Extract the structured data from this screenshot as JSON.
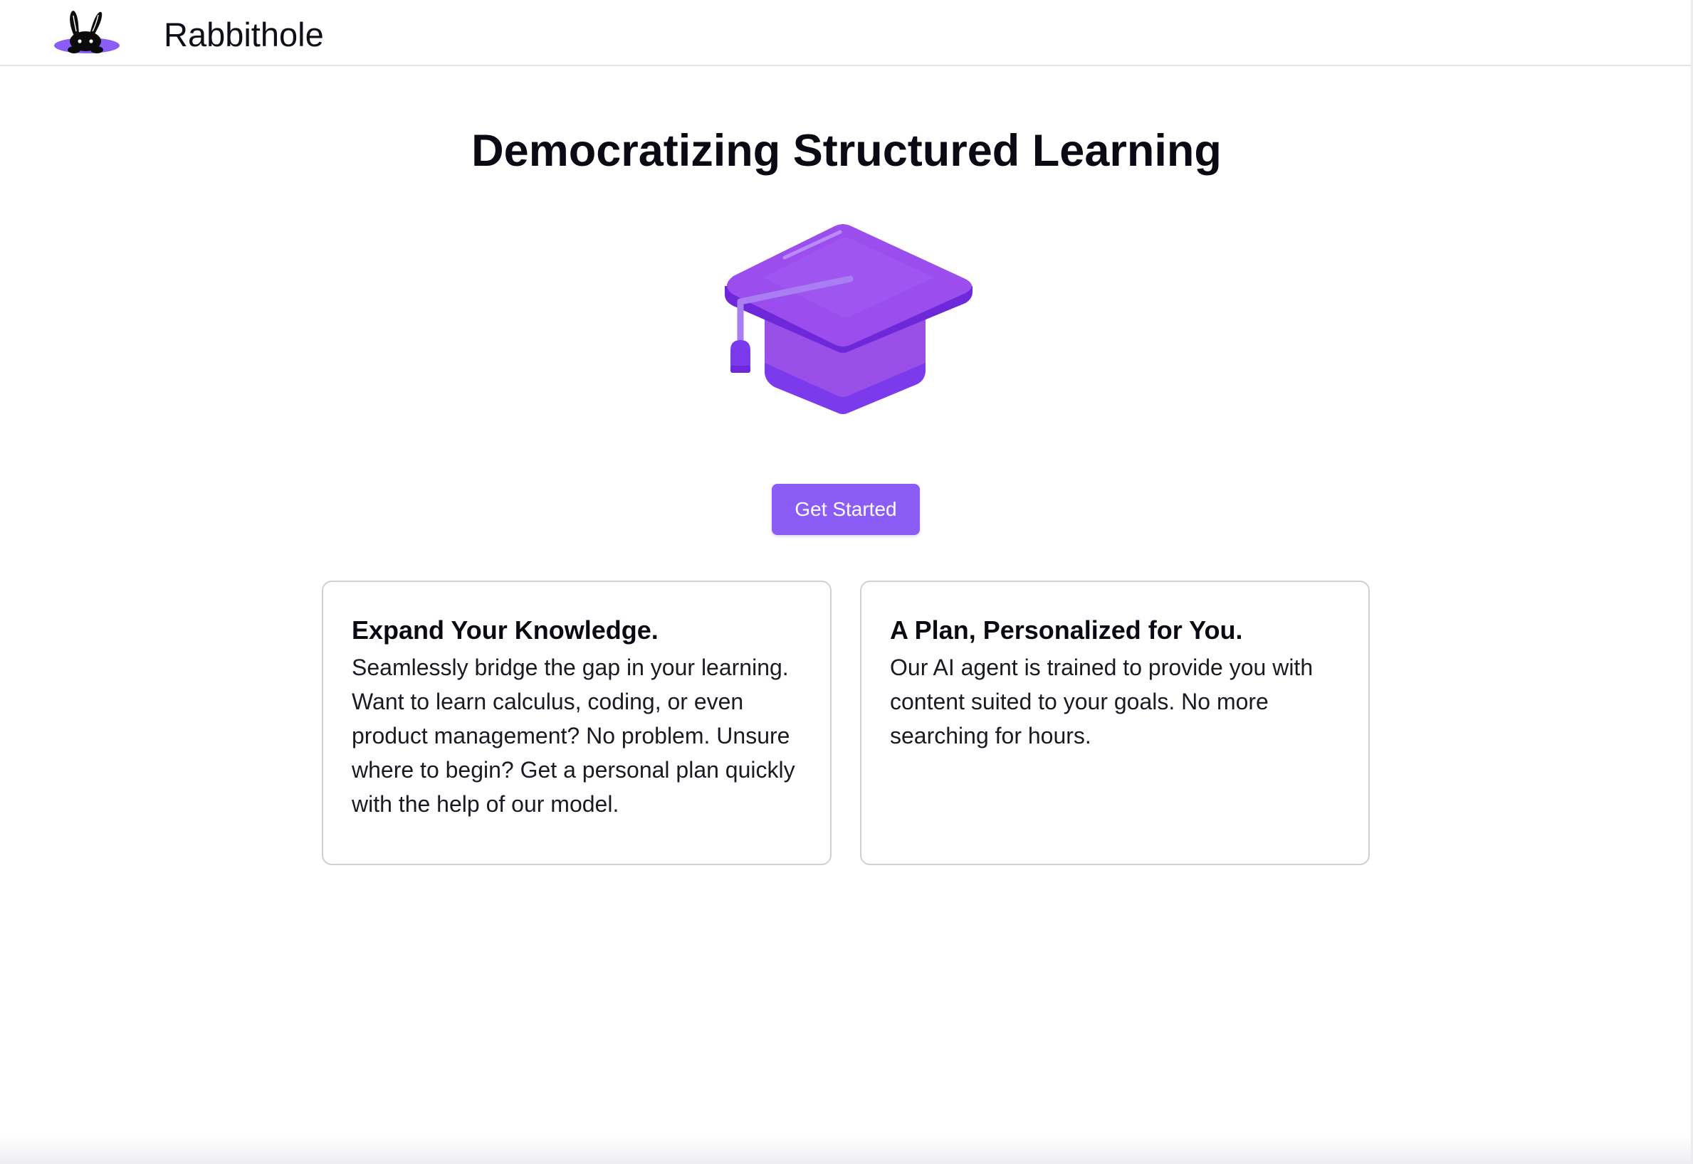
{
  "header": {
    "brand": "Rabbithole",
    "logo_icon": "rabbit-in-hole-icon"
  },
  "hero": {
    "title": "Democratizing Structured Learning",
    "illustration_icon": "graduation-cap-icon",
    "cta_label": "Get Started"
  },
  "features": [
    {
      "title": "Expand Your Knowledge.",
      "body": "Seamlessly bridge the gap in your learning. Want to learn calculus, coding, or even product management? No problem. Unsure where to begin? Get a personal plan quickly with the help of our model."
    },
    {
      "title": "A Plan, Personalized for You.",
      "body": "Our AI agent is trained to provide you with content suited to your goals. No more searching for hours."
    }
  ],
  "colors": {
    "accent": "#8b5cf6",
    "cap_top": "#9a4fe8",
    "cap_dark": "#6d28d9",
    "text": "#0a0a14",
    "card_border": "#cfcfd6"
  }
}
